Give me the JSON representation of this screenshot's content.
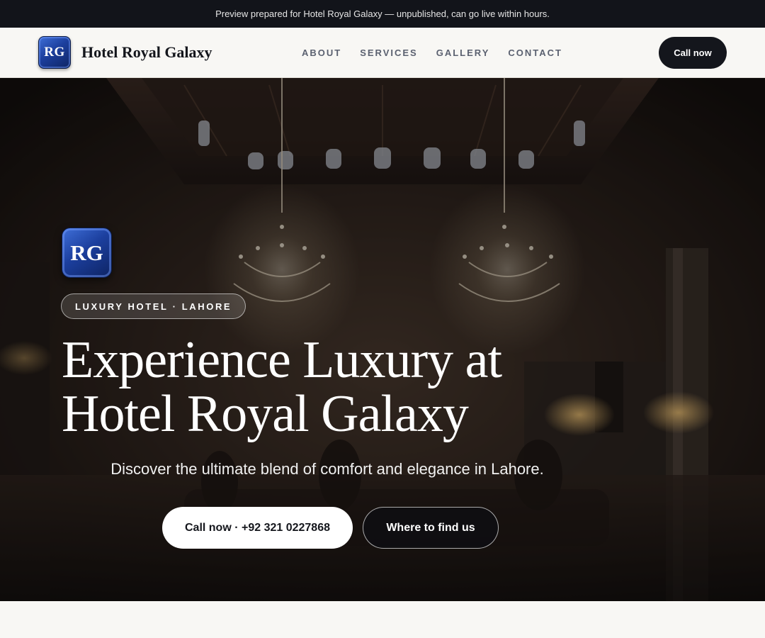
{
  "preview_banner": {
    "text": "Preview prepared for Hotel Royal Galaxy — unpublished, can go live within hours."
  },
  "header": {
    "logo_text": "RG",
    "brand_name": "Hotel Royal Galaxy",
    "nav": [
      {
        "label": "ABOUT"
      },
      {
        "label": "SERVICES"
      },
      {
        "label": "GALLERY"
      },
      {
        "label": "CONTACT"
      }
    ],
    "cta_label": "Call now"
  },
  "hero": {
    "logo_text": "RG",
    "tag": "LUXURY HOTEL · LAHORE",
    "title_line1": "Experience Luxury at",
    "title_line2": "Hotel Royal Galaxy",
    "subtitle": "Discover the ultimate blend of comfort and elegance in Lahore.",
    "primary_button": "Call now · +92 321 0227868",
    "secondary_button": "Where to find us",
    "background_image": "hotel-lobby-chandeliers-photo"
  },
  "colors": {
    "banner_bg": "#12141a",
    "header_bg": "#f8f7f4",
    "accent_dark": "#14161c",
    "logo_blue": "#1c3f9e",
    "nav_text": "#5b6170"
  }
}
